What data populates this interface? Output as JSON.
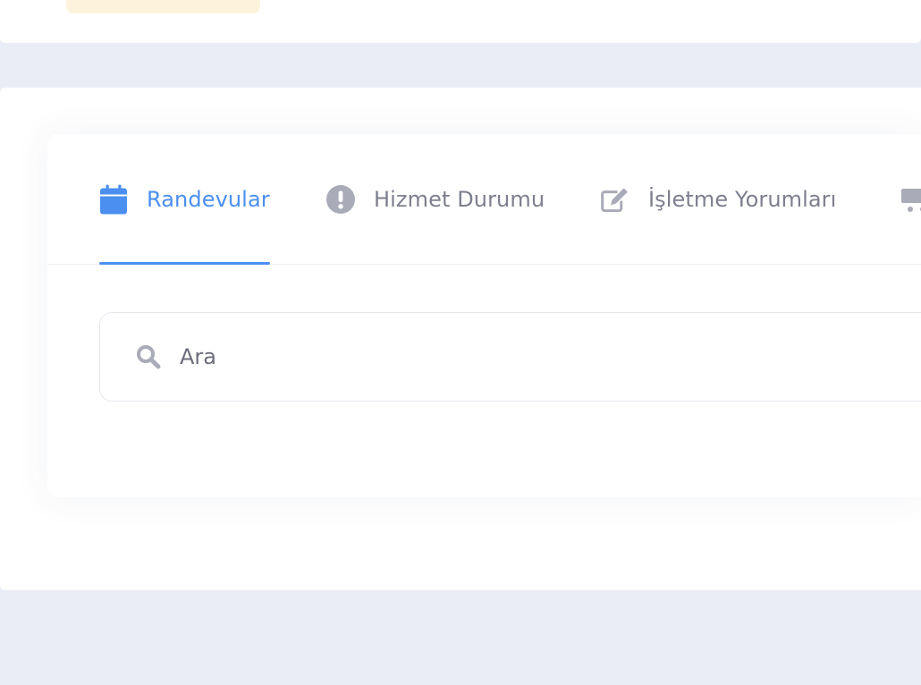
{
  "colors": {
    "accent": "#4b8ff0",
    "tab_inactive": "#7d7f8f",
    "icon_inactive": "#a9abb8",
    "page_background": "#ebedf6",
    "pill": "#fdf3dc"
  },
  "tabs": [
    {
      "label": "Randevular",
      "icon": "calendar-icon",
      "active": true
    },
    {
      "label": "Hizmet Durumu",
      "icon": "exclamation-circle-icon",
      "active": false
    },
    {
      "label": "İşletme Yorumları",
      "icon": "edit-icon",
      "active": false
    },
    {
      "label": "",
      "icon": "cart-icon",
      "active": false
    }
  ],
  "search": {
    "placeholder": "Ara",
    "value": "",
    "icon": "search-icon"
  }
}
